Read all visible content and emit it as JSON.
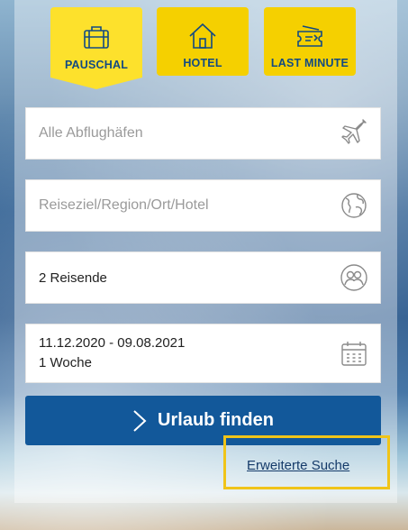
{
  "tabs": [
    {
      "label": "PAUSCHAL",
      "icon": "suitcase-icon",
      "active": true
    },
    {
      "label": "HOTEL",
      "icon": "house-icon",
      "active": false
    },
    {
      "label": "LAST MINUTE",
      "icon": "ticket-icon",
      "active": false
    }
  ],
  "form": {
    "departure_placeholder": "Alle Abflughäfen",
    "destination_placeholder": "Reiseziel/Region/Ort/Hotel",
    "travelers_value": "2 Reisende",
    "dates_value": "11.12.2020 - 09.08.2021",
    "duration_value": "1 Woche"
  },
  "search_button_label": "Urlaub finden",
  "advanced_search_label": "Erweiterte Suche",
  "colors": {
    "accent_yellow": "#f5d000",
    "primary_blue": "#12589a",
    "highlight_box": "#f0c419"
  }
}
